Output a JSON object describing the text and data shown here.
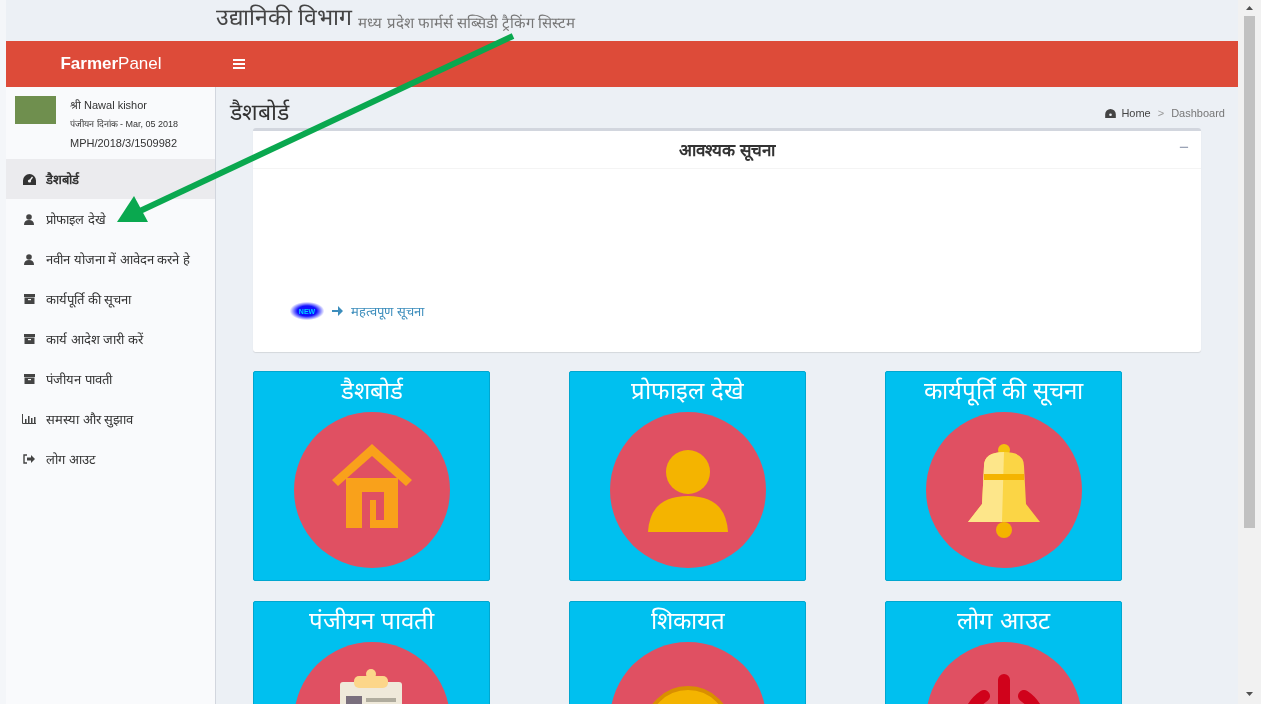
{
  "header": {
    "title": "उद्यानिकी विभाग",
    "subtitle": "मध्य प्रदेश फार्मर्स सब्सिडी ट्रैकिंग सिस्टम"
  },
  "navbar": {
    "brand_bold": "Farmer",
    "brand_light": "Panel"
  },
  "user": {
    "name": "श्री Nawal kishor",
    "registered": "पंजीयन दिनांक - Mar, 05 2018",
    "id": "MPH/2018/3/1509982"
  },
  "sidebar": {
    "items": [
      {
        "label": "डैशबोर्ड",
        "kind": "dashboard",
        "selected": true
      },
      {
        "label": "प्रोफाइल देखे",
        "kind": "user",
        "selected": false
      },
      {
        "label": "नवीन योजना में आवेदन करने हे",
        "kind": "user",
        "selected": false
      },
      {
        "label": "कार्यपूर्ति की सूचना",
        "kind": "archive",
        "selected": false
      },
      {
        "label": "कार्य आदेश जारी करें",
        "kind": "archive",
        "selected": false
      },
      {
        "label": "पंजीयन पावती",
        "kind": "archive",
        "selected": false
      },
      {
        "label": "समस्या और सुझाव",
        "kind": "chart",
        "selected": false
      },
      {
        "label": "लोग आउट",
        "kind": "signout",
        "selected": false
      }
    ]
  },
  "page": {
    "title": "डैशबोर्ड",
    "breadcrumb": [
      {
        "label": "Home"
      },
      {
        "label": "Dashboard"
      }
    ],
    "separator": ">"
  },
  "notice": {
    "title": "आवश्यक सूचना",
    "collapse": "−",
    "badge": "NEW",
    "link": "महत्वपूण सूचना"
  },
  "tiles": [
    {
      "label": "डैशबोर्ड",
      "kind": "home"
    },
    {
      "label": "प्रोफाइल देखे",
      "kind": "person"
    },
    {
      "label": "कार्यपूर्ति की सूचना",
      "kind": "bell"
    },
    {
      "label": "पंजीयन पावती",
      "kind": "clipboard"
    },
    {
      "label": "शिकायत",
      "kind": "coin"
    },
    {
      "label": "लोग आउट",
      "kind": "power"
    }
  ]
}
